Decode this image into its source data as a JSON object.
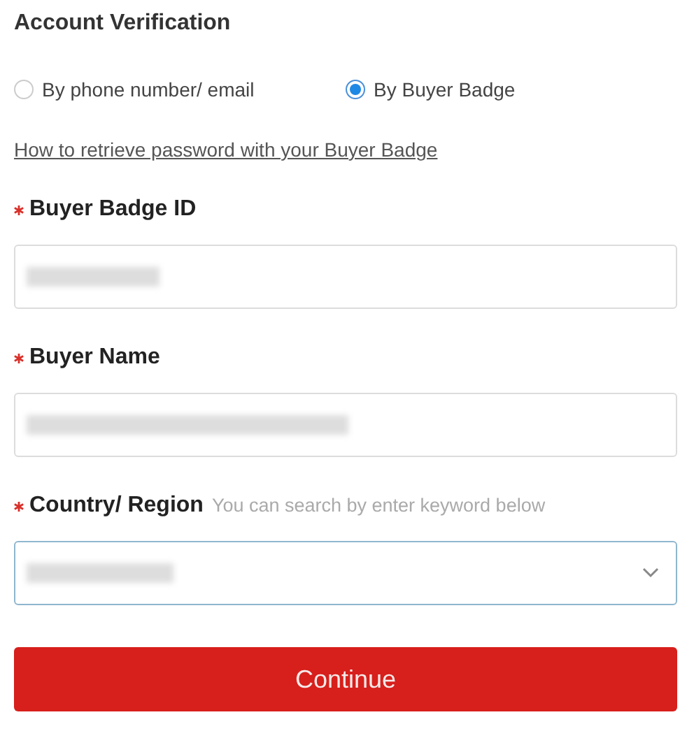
{
  "title": "Account Verification",
  "methods": [
    {
      "label": "By phone number/ email",
      "selected": false
    },
    {
      "label": "By Buyer Badge",
      "selected": true
    }
  ],
  "help_link": "How to retrieve password with your Buyer Badge",
  "fields": [
    {
      "label": "Buyer Badge ID",
      "required": true,
      "kind": "text",
      "focused": false
    },
    {
      "label": "Buyer Name",
      "required": true,
      "kind": "text",
      "focused": false
    },
    {
      "label": "Country/ Region",
      "hint": "You can search by enter keyword below",
      "required": true,
      "kind": "select",
      "focused": true
    }
  ],
  "submit": "Continue"
}
